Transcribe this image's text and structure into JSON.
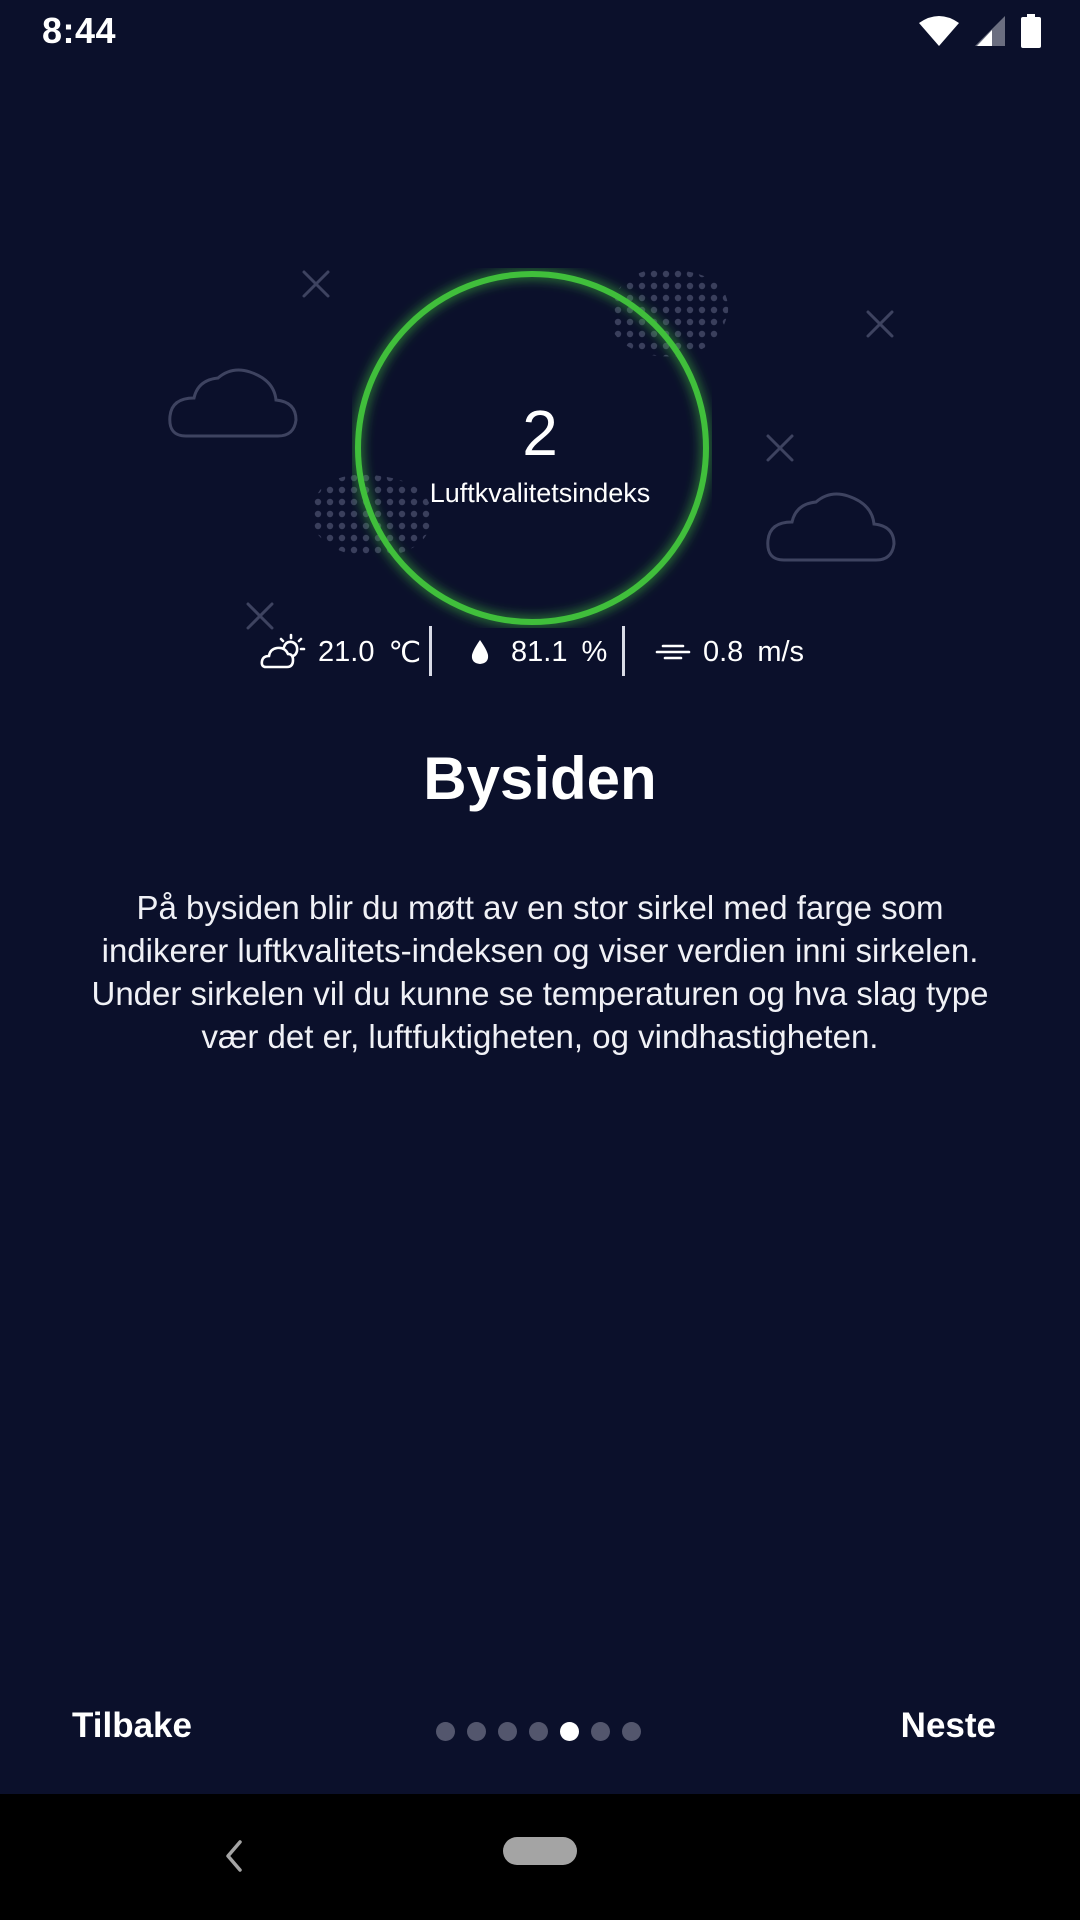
{
  "status_bar": {
    "time": "8:44",
    "icons": [
      "wifi-icon",
      "signal-icon",
      "battery-icon"
    ]
  },
  "aqi": {
    "value": "2",
    "label": "Luftkvalitetsindeks",
    "ring_color": "#3fbf3a",
    "level": 2
  },
  "weather": {
    "temperature": {
      "icon": "partly-cloudy-icon",
      "value": "21.0",
      "unit": "℃"
    },
    "humidity": {
      "icon": "water-drop-icon",
      "value": "81.1",
      "unit": "%"
    },
    "wind": {
      "icon": "wind-icon",
      "value": "0.8",
      "unit": "m/s"
    }
  },
  "page": {
    "title": "Bysiden",
    "description": "På bysiden blir du møtt av en stor sirkel med farge som indikerer luftkvalitets-indeksen og viser verdien inni sirkelen. Under sirkelen vil du kunne se temperaturen og hva slag type vær det er, luftfuktigheten, og vindhastigheten."
  },
  "nav": {
    "back_label": "Tilbake",
    "next_label": "Neste",
    "page_count": 7,
    "current_page": 5
  },
  "colors": {
    "background": "#0b102b",
    "accent": "#3fbf3a",
    "decoration": "#3a3f5c"
  }
}
